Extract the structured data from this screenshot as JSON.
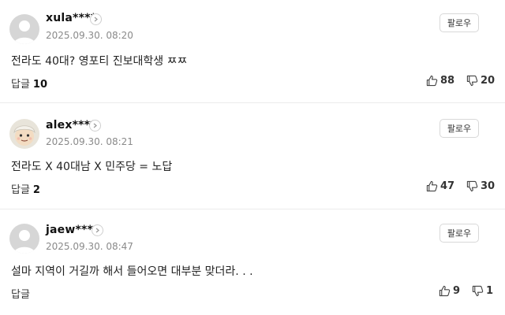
{
  "comments": [
    {
      "username": "xula****",
      "date": "2025.09.30. 08:20",
      "follow_label": "팔로우",
      "text": "전라도 40대? 영포티 진보대학생 ㅉㅉ",
      "reply_label": "답글",
      "reply_count": "10",
      "likes": "88",
      "dislikes": "20",
      "avatar": "default-gray"
    },
    {
      "username": "alex****",
      "date": "2025.09.30. 08:21",
      "follow_label": "팔로우",
      "text": "전라도 X 40대남 X 민주당 = 노답",
      "reply_label": "답글",
      "reply_count": "2",
      "likes": "47",
      "dislikes": "30",
      "avatar": "cartoon-face"
    },
    {
      "username": "jaew****",
      "date": "2025.09.30. 08:47",
      "follow_label": "팔로우",
      "text": "설마 지역이 거길까 해서 들어오면 대부분 맞더라. . .",
      "reply_label": "답글",
      "reply_count": "",
      "likes": "9",
      "dislikes": "1",
      "avatar": "default-gray"
    }
  ],
  "icons": {
    "like": "thumbs-up-icon",
    "dislike": "thumbs-down-icon",
    "profile_link": "chevron-right-icon"
  },
  "colors": {
    "date": "#8a8a8a",
    "divider": "#ebebeb",
    "follow_border": "#d8d8d8"
  }
}
